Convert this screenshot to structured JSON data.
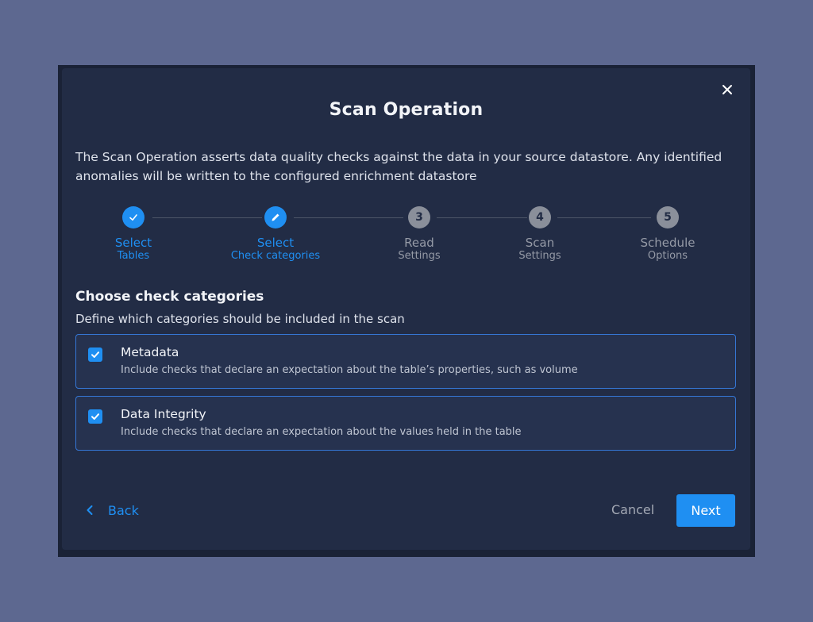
{
  "dialog": {
    "title": "Scan Operation",
    "description": "The Scan Operation asserts data quality checks against the data in your source datastore. Any identified anomalies will be written to the configured enrichment datastore"
  },
  "steps": [
    {
      "number": "",
      "title": "Select",
      "subtitle": "Tables",
      "state": "completed",
      "icon": "check-icon"
    },
    {
      "number": "",
      "title": "Select",
      "subtitle": "Check categories",
      "state": "current",
      "icon": "pencil-icon"
    },
    {
      "number": "3",
      "title": "Read",
      "subtitle": "Settings",
      "state": "pending"
    },
    {
      "number": "4",
      "title": "Scan",
      "subtitle": "Settings",
      "state": "pending"
    },
    {
      "number": "5",
      "title": "Schedule",
      "subtitle": "Options",
      "state": "pending"
    }
  ],
  "section": {
    "title": "Choose check categories",
    "subtitle": "Define which categories should be included in the scan"
  },
  "options": [
    {
      "label": "Metadata",
      "description": "Include checks that declare an expectation about the table’s properties, such as volume",
      "checked": true
    },
    {
      "label": "Data Integrity",
      "description": "Include checks that declare an expectation about the values held in the table",
      "checked": true
    }
  ],
  "footer": {
    "back_label": "Back",
    "cancel_label": "Cancel",
    "next_label": "Next"
  },
  "colors": {
    "accent": "#1f8ff2",
    "modal_bg": "#222c45",
    "page_bg": "#5d6890"
  }
}
